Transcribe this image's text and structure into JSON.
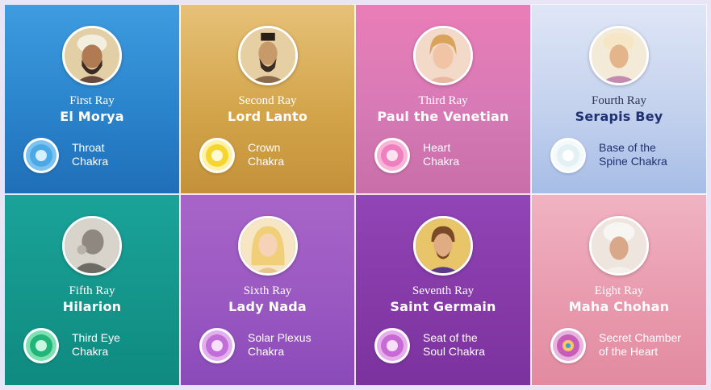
{
  "rays": [
    {
      "ray": "First Ray",
      "name": "El Morya",
      "chakra_line1": "Throat",
      "chakra_line2": "Chakra",
      "color": "#2a86d0",
      "chakra_color": "#4aa9e6",
      "icon": "throat-chakra-icon"
    },
    {
      "ray": "Second Ray",
      "name": "Lord Lanto",
      "chakra_line1": "Crown",
      "chakra_line2": "Chakra",
      "color": "#d5a84c",
      "chakra_color": "#f5d530",
      "icon": "crown-chakra-icon"
    },
    {
      "ray": "Third Ray",
      "name": "Paul the Venetian",
      "chakra_line1": "Heart",
      "chakra_line2": "Chakra",
      "color": "#d97ab6",
      "chakra_color": "#ef7fbf",
      "icon": "heart-chakra-icon"
    },
    {
      "ray": "Fourth Ray",
      "name": "Serapis Bey",
      "chakra_line1": "Base of the",
      "chakra_line2": "Spine Chakra",
      "color": "#b5c8ea",
      "chakra_color": "#e3f0f4",
      "icon": "base-of-spine-chakra-icon"
    },
    {
      "ray": "Fifth Ray",
      "name": "Hilarion",
      "chakra_line1": "Third Eye",
      "chakra_line2": "Chakra",
      "color": "#169e92",
      "chakra_color": "#22b57a",
      "icon": "third-eye-chakra-icon"
    },
    {
      "ray": "Sixth Ray",
      "name": "Lady Nada",
      "chakra_line1": "Solar Plexus",
      "chakra_line2": "Chakra",
      "color": "#9f5fc6",
      "chakra_color": "#c26ed8",
      "icon": "solar-plexus-chakra-icon"
    },
    {
      "ray": "Seventh Ray",
      "name": "Saint Germain",
      "chakra_line1": "Seat of the",
      "chakra_line2": "Soul Chakra",
      "color": "#8a3eae",
      "chakra_color": "#c76ad6",
      "icon": "seat-of-soul-chakra-icon"
    },
    {
      "ray": "Eight Ray",
      "name": "Maha Chohan",
      "chakra_line1": "Secret Chamber",
      "chakra_line2": "of the Heart",
      "color": "#e898ac",
      "chakra_color": "#c85db8",
      "icon": "secret-chamber-chakra-icon"
    }
  ]
}
